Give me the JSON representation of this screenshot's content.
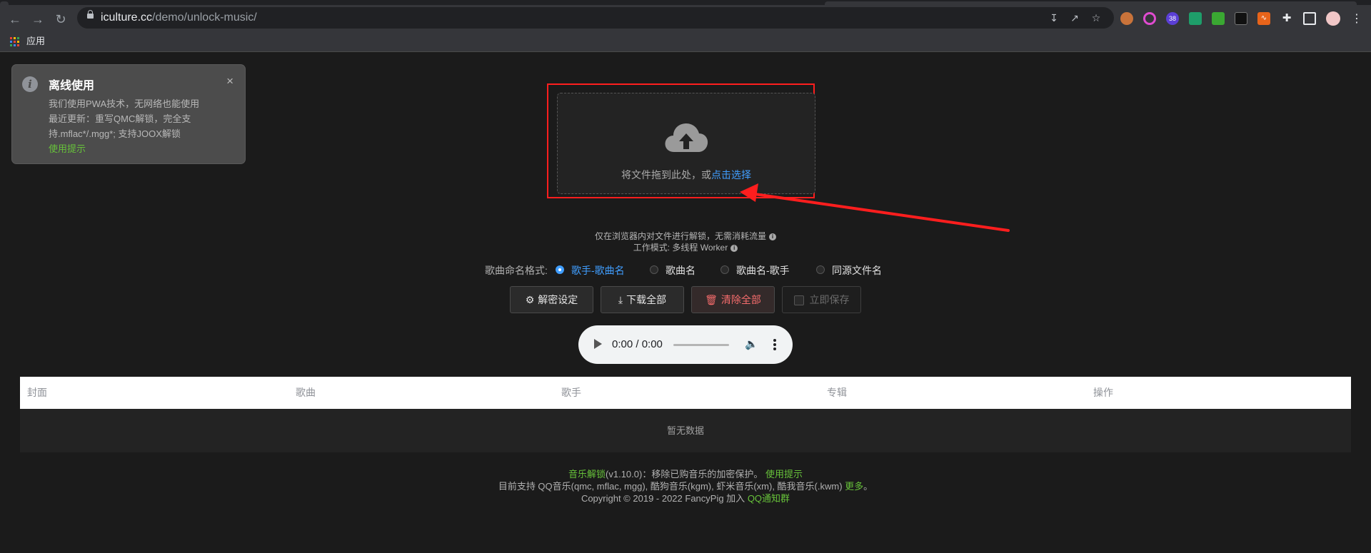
{
  "browser": {
    "url_host": "iculture.cc",
    "url_path": "/demo/unlock-music/",
    "bookmarks_apps_label": "应用",
    "extension_badge": "38",
    "icons": [
      "back-icon",
      "forward-icon",
      "reload-icon",
      "lock-icon",
      "install-icon",
      "share-icon",
      "star-icon",
      "extensions-icon",
      "sidepanel-icon",
      "profile-avatar"
    ]
  },
  "notification": {
    "title": "离线使用",
    "line1": "我们使用PWA技术，无网络也能使用",
    "line2": "最近更新：重写QMC解锁，完全支持.mflac*/.mgg*; 支持JOOX解锁",
    "link": "使用提示",
    "close_symbol": "×"
  },
  "upload": {
    "text": "将文件拖到此处，或",
    "link": "点击选择"
  },
  "tips": {
    "line1": "仅在浏览器内对文件进行解锁，无需消耗流量",
    "line2": "工作模式: 多线程 Worker"
  },
  "naming": {
    "label": "歌曲命名格式:",
    "options": [
      "歌手-歌曲名",
      "歌曲名",
      "歌曲名-歌手",
      "同源文件名"
    ],
    "selected": "歌手-歌曲名"
  },
  "buttons": {
    "settings": "解密设定",
    "download_all": "下载全部",
    "clear_all": "清除全部",
    "save_now": "立即保存"
  },
  "player": {
    "time": "0:00 / 0:00"
  },
  "table": {
    "headers": [
      "封面",
      "歌曲",
      "歌手",
      "专辑",
      "操作"
    ],
    "empty_text": "暂无数据"
  },
  "footer": {
    "l1_link": "音乐解锁",
    "l1_version": "(v1.10.0)：移除已购音乐的加密保护。",
    "l1_help": "使用提示",
    "l2_text": "目前支持 QQ音乐(qmc, mflac, mgg), 酷狗音乐(kgm), 虾米音乐(xm), 酷我音乐(.kwm)",
    "l2_more": "更多",
    "l2_end": "。",
    "l3_text": "Copyright © 2019 - 2022 FancyPig 加入",
    "l3_link": "QQ通知群"
  },
  "colors": {
    "accent": "#409eff",
    "success": "#67c23a",
    "danger": "#f56c6c",
    "annotation": "#ff1e1e"
  }
}
